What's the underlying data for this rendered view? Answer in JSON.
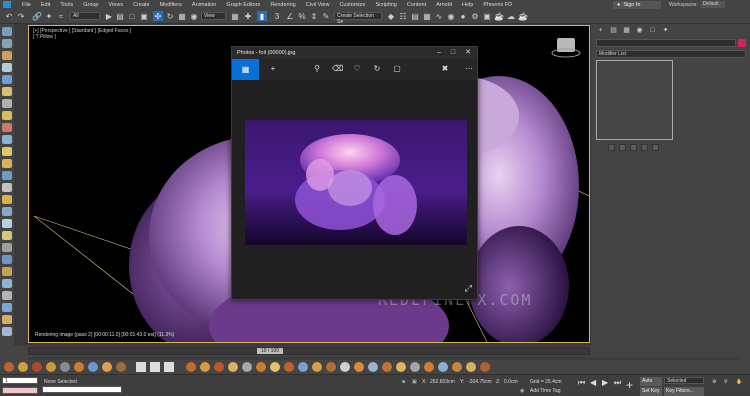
{
  "menubar": {
    "items": [
      "File",
      "Edit",
      "Tools",
      "Group",
      "Views",
      "Create",
      "Modifiers",
      "Animation",
      "Graph Editors",
      "Rendering",
      "Civil View",
      "Customize",
      "Scripting",
      "Content",
      "Arnold",
      "Help",
      "Phoenix FD"
    ],
    "sign_in": "Sign In",
    "workspaces_label": "Workspaces:",
    "workspaces_value": "Default"
  },
  "toolbar": {
    "filter_value": "All",
    "view_value": "View",
    "selection_set_placeholder": "Create Selection Se"
  },
  "viewport": {
    "label_line1": "[+] [Perspective ] [Standard ] [Edged Faces ]",
    "label_line2": "[ ?.Pillow ]",
    "status": "Rendering image (pass 2) [00:00:11.0] [00:01:43.0 est]   (11.3%)",
    "watermark": "REDEFINEFX.COM"
  },
  "photos_window": {
    "title": "Photos - foil (00000).jpg",
    "colors": {
      "accent": "#0a6fd6"
    }
  },
  "command_panel": {
    "modifier_list_label": "Modifier List",
    "color_swatch": "#d0245f"
  },
  "timeline": {
    "slider_label": "10 / 100",
    "ticks": [
      "0",
      "5",
      "10",
      "15",
      "20",
      "25",
      "30",
      "35",
      "40",
      "45",
      "50",
      "55",
      "60",
      "65",
      "70",
      "75",
      "80",
      "85",
      "90",
      "95",
      "100"
    ]
  },
  "status": {
    "selection": "None Selected",
    "maxscript_value": "1",
    "x_label": "X:",
    "x_value": "262.603cm",
    "y_label": "Y:",
    "y_value": "-204.75cm",
    "z_label": "Z:",
    "z_value": "0.0cm",
    "grid": "Grid = 25.4cm",
    "add_time_tag": "Add Time Tag",
    "auto_key": "Auto Key",
    "set_key": "Set Key",
    "selected_value": "Selected",
    "key_filters": "Key Filters..."
  }
}
